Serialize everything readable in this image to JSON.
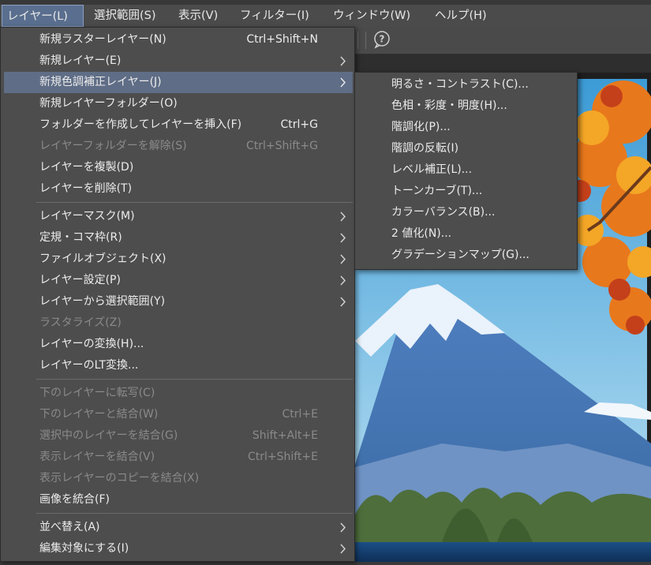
{
  "menubar": {
    "items": [
      {
        "label": "レイヤー(L)",
        "active": true
      },
      {
        "label": "選択範囲(S)"
      },
      {
        "label": "表示(V)"
      },
      {
        "label": "フィルター(I)"
      },
      {
        "label": "ウィンドウ(W)"
      },
      {
        "label": "ヘルプ(H)"
      }
    ]
  },
  "toolbar": {
    "help_icon": "help-question-icon"
  },
  "layer_menu": {
    "items": [
      {
        "label": "新規ラスターレイヤー(N)",
        "shortcut": "Ctrl+Shift+N"
      },
      {
        "label": "新規レイヤー(E)",
        "submenu": true
      },
      {
        "label": "新規色調補正レイヤー(J)",
        "submenu": true,
        "highlighted": true
      },
      {
        "label": "新規レイヤーフォルダー(O)"
      },
      {
        "label": "フォルダーを作成してレイヤーを挿入(F)",
        "shortcut": "Ctrl+G"
      },
      {
        "label": "レイヤーフォルダーを解除(S)",
        "shortcut": "Ctrl+Shift+G",
        "disabled": true
      },
      {
        "label": "レイヤーを複製(D)"
      },
      {
        "label": "レイヤーを削除(T)"
      },
      {
        "label": "レイヤーマスク(M)",
        "submenu": true
      },
      {
        "label": "定規・コマ枠(R)",
        "submenu": true
      },
      {
        "label": "ファイルオブジェクト(X)",
        "submenu": true
      },
      {
        "label": "レイヤー設定(P)",
        "submenu": true
      },
      {
        "label": "レイヤーから選択範囲(Y)",
        "submenu": true
      },
      {
        "label": "ラスタライズ(Z)",
        "disabled": true
      },
      {
        "label": "レイヤーの変換(H)..."
      },
      {
        "label": "レイヤーのLT変換..."
      },
      {
        "label": "下のレイヤーに転写(C)",
        "disabled": true
      },
      {
        "label": "下のレイヤーと結合(W)",
        "shortcut": "Ctrl+E",
        "disabled": true
      },
      {
        "label": "選択中のレイヤーを結合(G)",
        "shortcut": "Shift+Alt+E",
        "disabled": true
      },
      {
        "label": "表示レイヤーを結合(V)",
        "shortcut": "Ctrl+Shift+E",
        "disabled": true
      },
      {
        "label": "表示レイヤーのコピーを結合(X)",
        "disabled": true
      },
      {
        "label": "画像を統合(F)"
      },
      {
        "label": "並べ替え(A)",
        "submenu": true
      },
      {
        "label": "編集対象にする(I)",
        "submenu": true
      }
    ]
  },
  "tone_submenu": {
    "items": [
      {
        "label": "明るさ・コントラスト(C)..."
      },
      {
        "label": "色相・彩度・明度(H)..."
      },
      {
        "label": "階調化(P)..."
      },
      {
        "label": "階調の反転(I)"
      },
      {
        "label": "レベル補正(L)..."
      },
      {
        "label": "トーンカーブ(T)..."
      },
      {
        "label": "カラーバランス(B)..."
      },
      {
        "label": "2 値化(N)..."
      },
      {
        "label": "グラデーションマップ(G)..."
      }
    ]
  },
  "colors": {
    "menu_bg": "#4d4d4d",
    "highlight": "#5f6d86",
    "disabled_text": "#8a8a8a",
    "text": "#ececec"
  }
}
